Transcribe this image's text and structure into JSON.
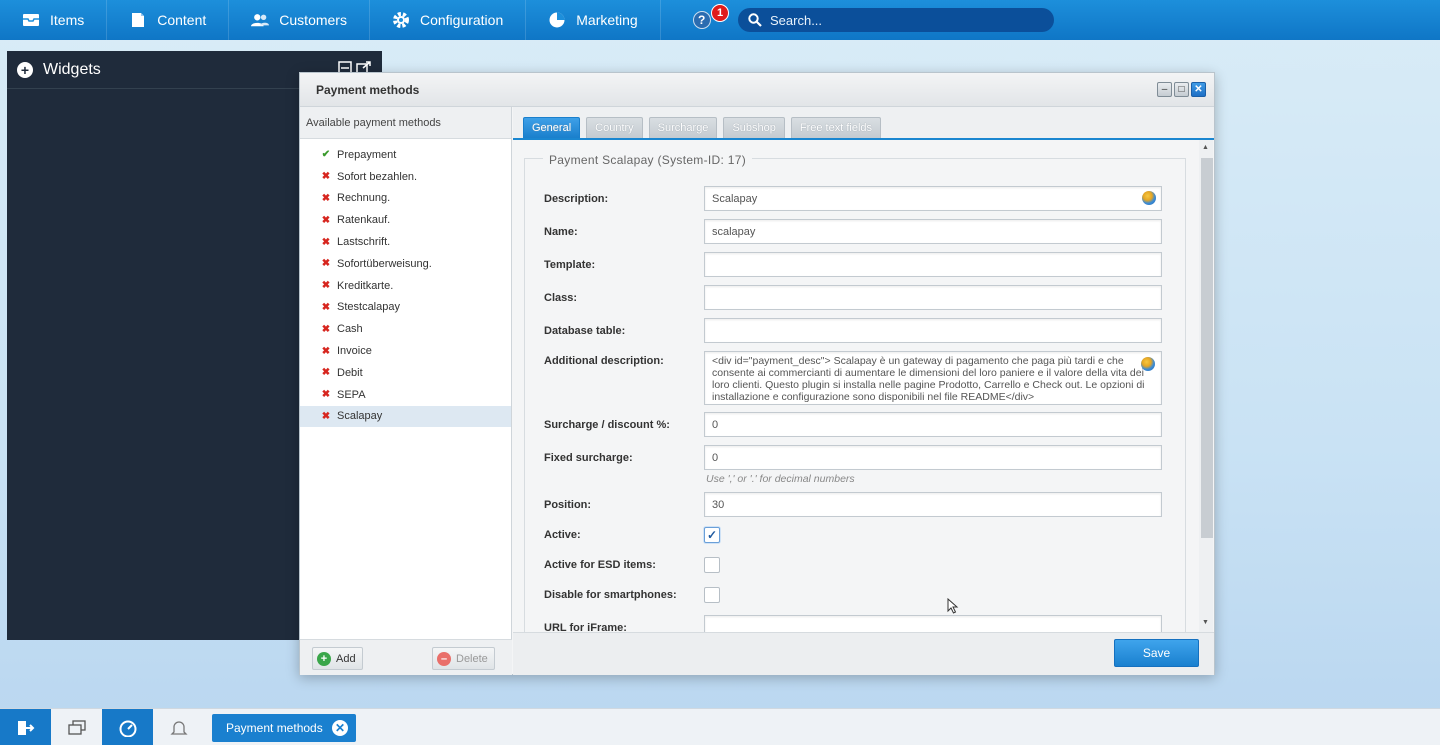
{
  "topnav": {
    "items": [
      {
        "label": "Items",
        "icon": "inbox-icon"
      },
      {
        "label": "Content",
        "icon": "document-icon"
      },
      {
        "label": "Customers",
        "icon": "users-icon"
      },
      {
        "label": "Configuration",
        "icon": "gear-icon"
      },
      {
        "label": "Marketing",
        "icon": "pie-chart-icon"
      }
    ],
    "help_label": "?",
    "notification_count": "1",
    "search_placeholder": "Search..."
  },
  "widgets": {
    "title": "Widgets"
  },
  "window": {
    "title": "Payment methods",
    "left": {
      "header": "Available payment methods",
      "items": [
        {
          "label": "Prepayment",
          "active": true
        },
        {
          "label": "Sofort bezahlen.",
          "active": false
        },
        {
          "label": "Rechnung.",
          "active": false
        },
        {
          "label": "Ratenkauf.",
          "active": false
        },
        {
          "label": "Lastschrift.",
          "active": false
        },
        {
          "label": "Sofortüberweisung.",
          "active": false
        },
        {
          "label": "Kreditkarte.",
          "active": false
        },
        {
          "label": "Stestcalapay",
          "active": false
        },
        {
          "label": "Cash",
          "active": false
        },
        {
          "label": "Invoice",
          "active": false
        },
        {
          "label": "Debit",
          "active": false
        },
        {
          "label": "SEPA",
          "active": false
        },
        {
          "label": "Scalapay",
          "active": false,
          "selected": true
        }
      ],
      "add_label": "Add",
      "delete_label": "Delete"
    },
    "tabs": [
      "General",
      "Country",
      "Surcharge",
      "Subshop",
      "Free text fields"
    ],
    "form": {
      "legend": "Payment Scalapay (System-ID: 17)",
      "description_label": "Description:",
      "description_value": "Scalapay",
      "name_label": "Name:",
      "name_value": "scalapay",
      "template_label": "Template:",
      "template_value": "",
      "class_label": "Class:",
      "class_value": "",
      "dbtable_label": "Database table:",
      "dbtable_value": "",
      "additional_label": "Additional description:",
      "additional_value": "<div id=\"payment_desc\">  Scalapay è un gateway di pagamento che paga più tardi e che consente ai commercianti di aumentare le dimensioni del loro paniere e il valore della vita dei loro clienti. Questo plugin si installa nelle pagine Prodotto, Carrello e Check out. Le opzioni di installazione e configurazione sono disponibili nel file README</div>",
      "surcharge_label": "Surcharge / discount %:",
      "surcharge_value": "0",
      "fixed_label": "Fixed surcharge:",
      "fixed_value": "0",
      "decimal_hint": "Use ',' or '.' for decimal numbers",
      "position_label": "Position:",
      "position_value": "30",
      "active_label": "Active:",
      "active_checked": true,
      "esd_label": "Active for ESD items:",
      "smartphones_label": "Disable for smartphones:",
      "iframe_label": "URL for iFrame:",
      "iframe_value": ""
    },
    "save_label": "Save"
  },
  "taskbar": {
    "task_label": "Payment methods"
  },
  "colors": {
    "nav_blue": "#1d8fdb",
    "accent": "#1a80cf",
    "dark_panel": "#1f2b3b",
    "error_red": "#d7261f",
    "success_green": "#3a9a2c"
  }
}
